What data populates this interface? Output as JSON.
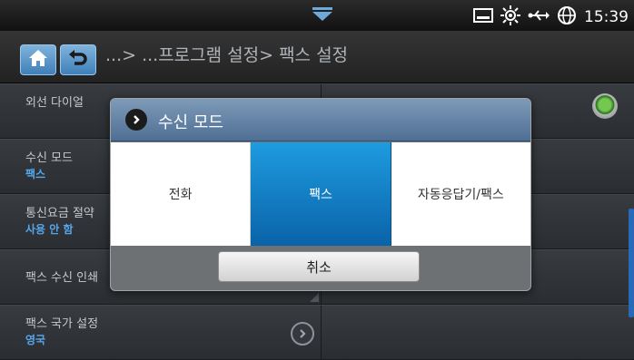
{
  "status_bar": {
    "time": "15:39",
    "icons": [
      "notification-arrow-icon",
      "tray-icon",
      "brightness-icon",
      "usb-icon",
      "network-globe-icon"
    ]
  },
  "header": {
    "icons": [
      "home-icon",
      "back-icon"
    ],
    "breadcrumb": "...> ...프로그램 설정> 팩스 설정"
  },
  "list": {
    "rows": [
      {
        "title": "외선 다이얼",
        "value": ""
      },
      {
        "title": "수신 모드",
        "value": "팩스"
      },
      {
        "title": "통신요금 절약",
        "value": "사용 안 함"
      },
      {
        "title": "팩스 수신 인쇄",
        "value": ""
      },
      {
        "title": "팩스 국가 설정",
        "value": "영국"
      }
    ]
  },
  "dialog": {
    "title": "수신 모드",
    "options": [
      "전화",
      "팩스",
      "자동응답기/팩스"
    ],
    "selected": "팩스",
    "cancel_label": "취소"
  },
  "colors": {
    "accent": "#1e9be0",
    "value_text": "#5fb6ff",
    "radio_on": "#7ed957"
  }
}
